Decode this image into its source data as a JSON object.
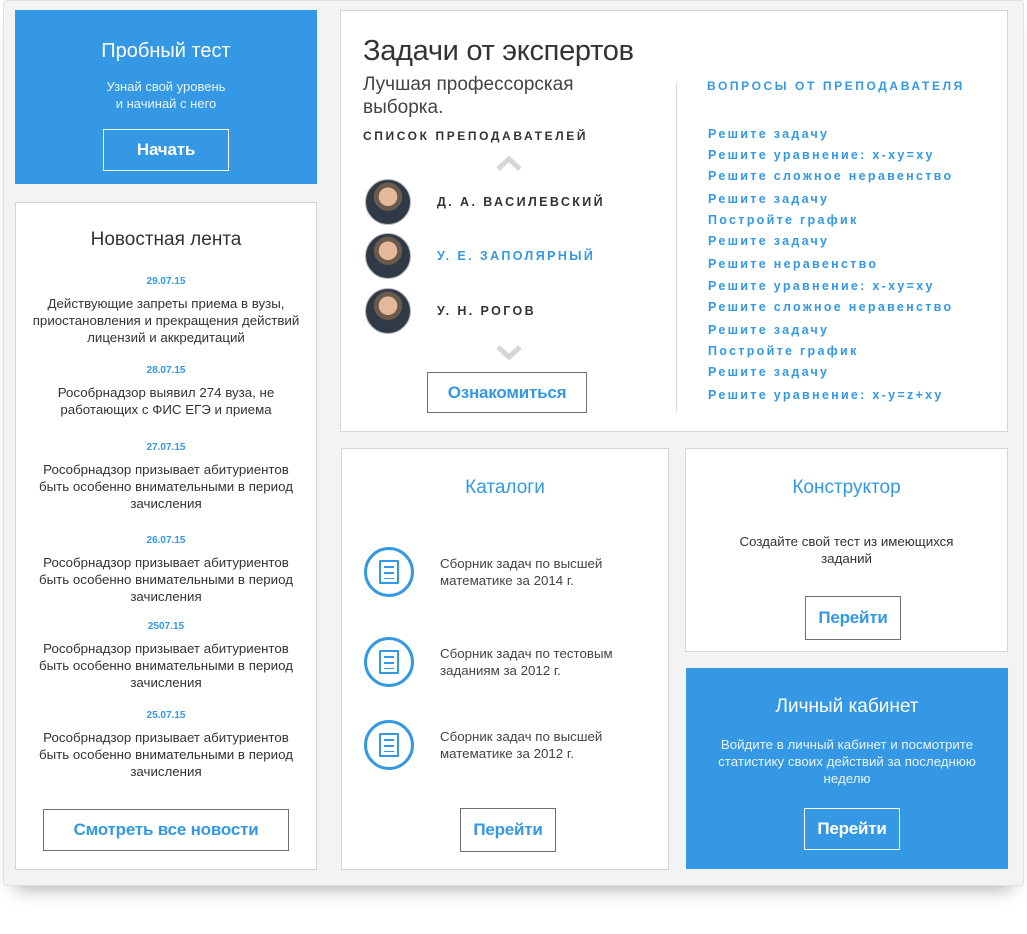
{
  "trial": {
    "title": "Пробный тест",
    "subtitle_line1": "Узнай свой уровень",
    "subtitle_line2": "и начинай с него",
    "button": "Начать"
  },
  "news": {
    "title": "Новостная лента",
    "items": [
      {
        "date": "29.07.15",
        "text": "Действующие запреты приема в вузы, приостановления и прекращения действий лицензий и аккредитаций"
      },
      {
        "date": "28.07.15",
        "text": "Рособрнадзор выявил 274 вуза, не работающих с ФИС ЕГЭ и приема"
      },
      {
        "date": "27.07.15",
        "text": "Рособрнадзор призывает абитуриентов быть особенно внимательными в период зачисления"
      },
      {
        "date": "26.07.15",
        "text": "Рособрнадзор призывает абитуриентов быть особенно внимательными в период зачисления"
      },
      {
        "date": "2507.15",
        "text": "Рособрнадзор призывает абитуриентов быть особенно внимательными в период зачисления"
      },
      {
        "date": "25.07.15",
        "text": "Рособрнадзор призывает абитуриентов быть особенно внимательными в период зачисления"
      }
    ],
    "button": "Смотреть все новости"
  },
  "experts": {
    "title": "Задачи от экспертов",
    "subtitle": "Лучшая профессорская выборка.",
    "list_title": "Список преподавателей",
    "teachers": [
      {
        "name": "Д. А. Василевский"
      },
      {
        "name": "У. Е. Заполярный"
      },
      {
        "name": "У. Н. Рогов"
      }
    ],
    "button": "Ознакомиться",
    "questions_title": "Вопросы от преподавателя",
    "questions": [
      "Решите задачу",
      "Решите уравнение: x-xy=xy",
      "Решите сложное неравенство",
      "Решите задачу",
      "Постройте график",
      "Решите задачу",
      "Решите неравенство",
      "Решите уравнение: x-xy=xy",
      "Решите сложное неравенство",
      "Решите задачу",
      "Постройте график",
      "Решите задачу",
      "Решите уравнение: x-y=z+xy"
    ]
  },
  "catalogs": {
    "title": "Каталоги",
    "items": [
      {
        "icon": "document-icon",
        "text": "Сборник задач по высшей математике за 2014 г."
      },
      {
        "icon": "document-icon",
        "text": "Сборник задач по тестовым заданиям за 2012 г."
      },
      {
        "icon": "document-icon",
        "text": "Сборник задач по высшей математике за 2012 г."
      }
    ],
    "button": "Перейти"
  },
  "constructor": {
    "title": "Конструктор",
    "subtitle": "Создайте свой тест из имеющихся заданий",
    "button": "Перейти"
  },
  "cabinet": {
    "title": "Личный кабинет",
    "subtitle": "Войдите в личный кабинет и посмотрите статистику своих действий за последнюю неделю",
    "button": "Перейти"
  },
  "colors": {
    "accent": "#3498e4"
  }
}
